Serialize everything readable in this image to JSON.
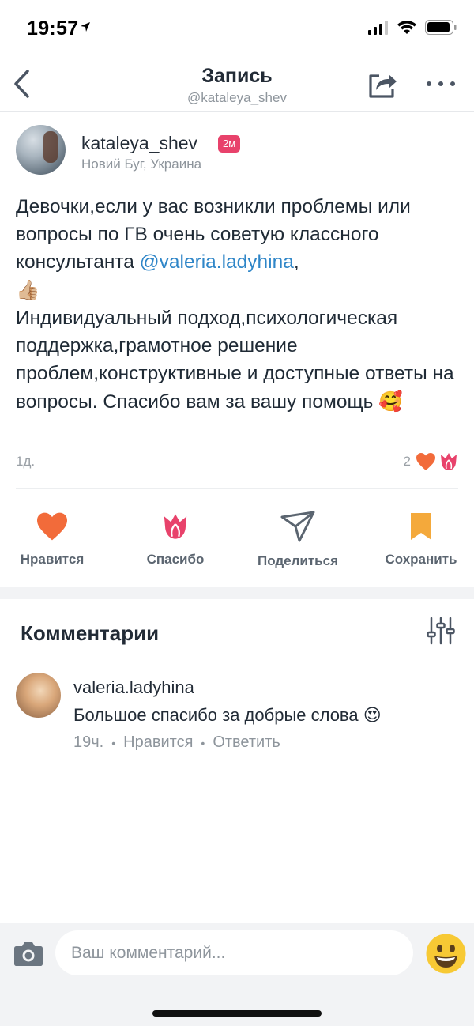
{
  "status_bar": {
    "time": "19:57"
  },
  "nav": {
    "title": "Запись",
    "subtitle": "@kataleya_shev"
  },
  "post": {
    "author": "kataleya_shev",
    "badge": "2м",
    "location": "Новий Буг, Украина",
    "text_line1_a": "Девочки,если у вас возникли проблемы или вопросы по ГВ очень советую классного консультанта ",
    "mention": "@valeria.ladyhina",
    "text_line1_b": ",",
    "thumbs_emoji": "👍🏼",
    "text_paragraph2": "Индивидуальный подход,психологическая поддержка,грамотное решение проблем,конструктивные и доступные ответы на вопросы. Спасибо вам за вашу помощь ",
    "smile_emoji": "🥰",
    "time": "1д.",
    "reaction_count": "2"
  },
  "actions": {
    "like": "Нравится",
    "thanks": "Спасибо",
    "share": "Поделиться",
    "save": "Сохранить"
  },
  "comments": {
    "title": "Комментарии",
    "items": [
      {
        "author": "valeria.ladyhina",
        "text": "Большое спасибо за добрые слова",
        "emoji": "😍",
        "time": "19ч.",
        "like_label": "Нравится",
        "reply_label": "Ответить"
      }
    ]
  },
  "composer": {
    "placeholder": "Ваш комментарий..."
  },
  "colors": {
    "heart": "#f26b3a",
    "tulip": "#e8426b",
    "bookmark": "#f4a93b",
    "mention": "#2f86c8"
  }
}
